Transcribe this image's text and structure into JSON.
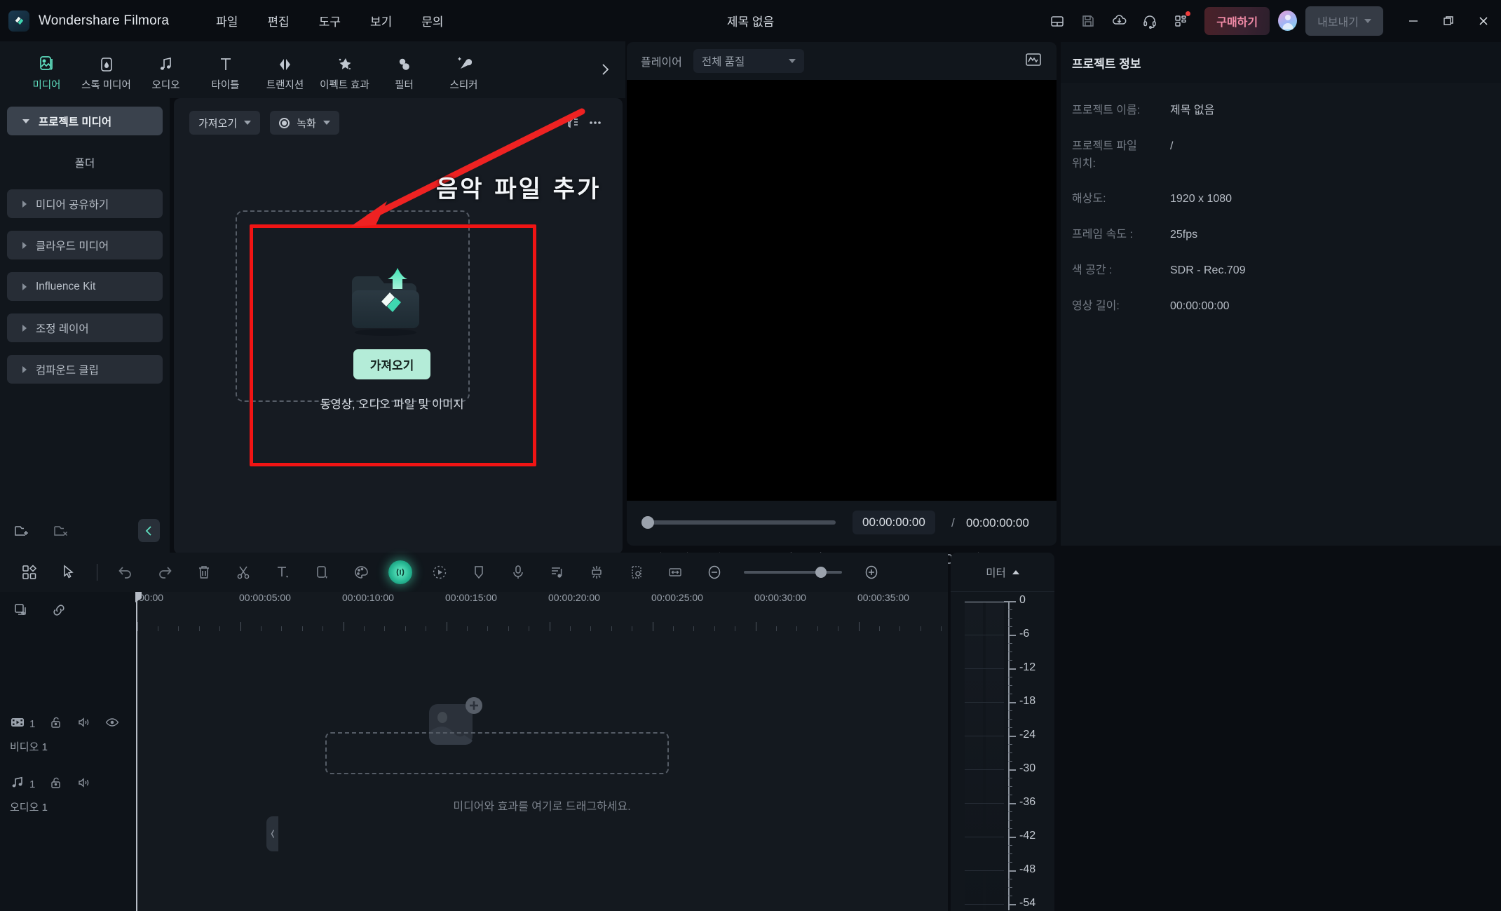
{
  "titlebar": {
    "app_name": "Wondershare Filmora",
    "doc_title": "제목 없음",
    "menus": [
      "파일",
      "편집",
      "도구",
      "보기",
      "문의"
    ],
    "icons": [
      "layout-icon",
      "save-icon",
      "cloud-upload-icon",
      "headset-support-icon",
      "apps-grid-icon"
    ],
    "buy_label": "구매하기",
    "export_label": "내보내기",
    "window_controls": [
      "minimize",
      "maximize",
      "close"
    ]
  },
  "tabs": [
    {
      "label": "미디어",
      "icon": "media-icon",
      "active": true
    },
    {
      "label": "스톡 미디어",
      "icon": "stock-media-icon",
      "active": false
    },
    {
      "label": "오디오",
      "icon": "audio-note-icon",
      "active": false
    },
    {
      "label": "타이틀",
      "icon": "title-text-icon",
      "active": false
    },
    {
      "label": "트랜지션",
      "icon": "transition-icon",
      "active": false
    },
    {
      "label": "이펙트 효과",
      "icon": "effects-sparkle-icon",
      "active": false
    },
    {
      "label": "필터",
      "icon": "filter-circles-icon",
      "active": false
    },
    {
      "label": "스티커",
      "icon": "sticker-icon",
      "active": false
    }
  ],
  "sidebar": {
    "items": [
      {
        "label": "프로젝트 미디어",
        "expanded": true,
        "primary": true
      },
      {
        "label": "폴더",
        "expanded": false,
        "primary": false,
        "plain": true
      },
      {
        "label": "미디어 공유하기",
        "expanded": false,
        "primary": false
      },
      {
        "label": "클라우드 미디어",
        "expanded": false,
        "primary": false
      },
      {
        "label": "Influence Kit",
        "expanded": false,
        "primary": false
      },
      {
        "label": "조정 레이어",
        "expanded": false,
        "primary": false
      },
      {
        "label": "컴파운드 클립",
        "expanded": false,
        "primary": false
      }
    ],
    "bottom_icons": [
      "new-folder-icon",
      "delete-folder-icon"
    ],
    "collapse_icon": "chevron-left-icon"
  },
  "media_panel": {
    "import_label": "가져오기",
    "record_label": "녹화",
    "filter_icon": "filter-sort-icon",
    "more_icon": "more-dots-icon",
    "dropzone": {
      "button_label": "가져오기",
      "caption": "동영상, 오디오 파일 및 이미지"
    }
  },
  "annotation": {
    "text": "음악 파일 추가",
    "box_color": "#f01414",
    "arrow_color": "#ee2222"
  },
  "player": {
    "label": "플레이어",
    "quality": "전체 품질",
    "quality_icon": "chevron-down-icon",
    "scope_icon": "waveform-scope-icon",
    "current_time": "00:00:00:00",
    "separator": "/",
    "total_time": "00:00:00:00",
    "transport": [
      "prev-frame-icon",
      "next-frame-icon",
      "play-icon",
      "stop-icon",
      "mark-in-icon",
      "mark-out-icon",
      "add-marker-icon",
      "marker-dropdown-icon",
      "screen-icon",
      "snapshot-camera-icon",
      "volume-icon",
      "fullscreen-icon"
    ]
  },
  "project_info": {
    "title": "프로젝트 정보",
    "rows": [
      {
        "key": "프로젝트 이름:",
        "value": "제목 없음"
      },
      {
        "key": "프로젝트 파일\n위치:",
        "value": "/"
      },
      {
        "key": "해상도:",
        "value": "1920 x 1080"
      },
      {
        "key": "프레임 속도 :",
        "value": "25fps"
      },
      {
        "key": "색 공간 :",
        "value": "SDR - Rec.709"
      },
      {
        "key": "영상 길이:",
        "value": "00:00:00:00"
      }
    ]
  },
  "timeline": {
    "toolbar_icons": [
      "apps-grid-icon",
      "select-tool-icon",
      "undo-icon",
      "redo-icon",
      "delete-trash-icon",
      "split-scissors-icon",
      "text-tool-icon",
      "crop-tool-icon",
      "color-palette-icon",
      "ai-assist-icon",
      "auto-highlight-icon",
      "keyframe-icon",
      "record-mic-icon",
      "audio-mix-icon",
      "green-screen-icon",
      "speed-ramp-icon",
      "fit-timeline-icon",
      "zoom-out-icon",
      "zoom-in-icon"
    ],
    "head_tools": [
      "add-track-icon",
      "link-clips-icon"
    ],
    "ruler_labels": [
      "00:00",
      "00:00:05:00",
      "00:00:10:00",
      "00:00:15:00",
      "00:00:20:00",
      "00:00:25:00",
      "00:00:30:00",
      "00:00:35:00"
    ],
    "tracks": [
      {
        "name": "비디오 1",
        "count": "1",
        "type_icon": "video-track-icon",
        "controls": [
          "unlock-icon",
          "mute-icon",
          "visibility-eye-icon"
        ]
      },
      {
        "name": "오디오 1",
        "count": "1",
        "type_icon": "audio-track-icon",
        "controls": [
          "unlock-icon",
          "mute-icon"
        ]
      }
    ],
    "hint": "미디어와 효과를 여기로 드래그하세요."
  },
  "meter": {
    "title": "미터",
    "collapse_icon": "caret-up-icon",
    "scale": [
      "0",
      "-6",
      "-12",
      "-18",
      "-24",
      "-30",
      "-36",
      "-42",
      "-48",
      "-54"
    ]
  },
  "colors": {
    "accent": "#5fe0c0",
    "import_btn_bg": "#b4ecd8",
    "buy_text": "#f08aa6",
    "annotation_red": "#f01414",
    "panel_bg": "#11161c",
    "app_bg": "#0a0d12"
  }
}
